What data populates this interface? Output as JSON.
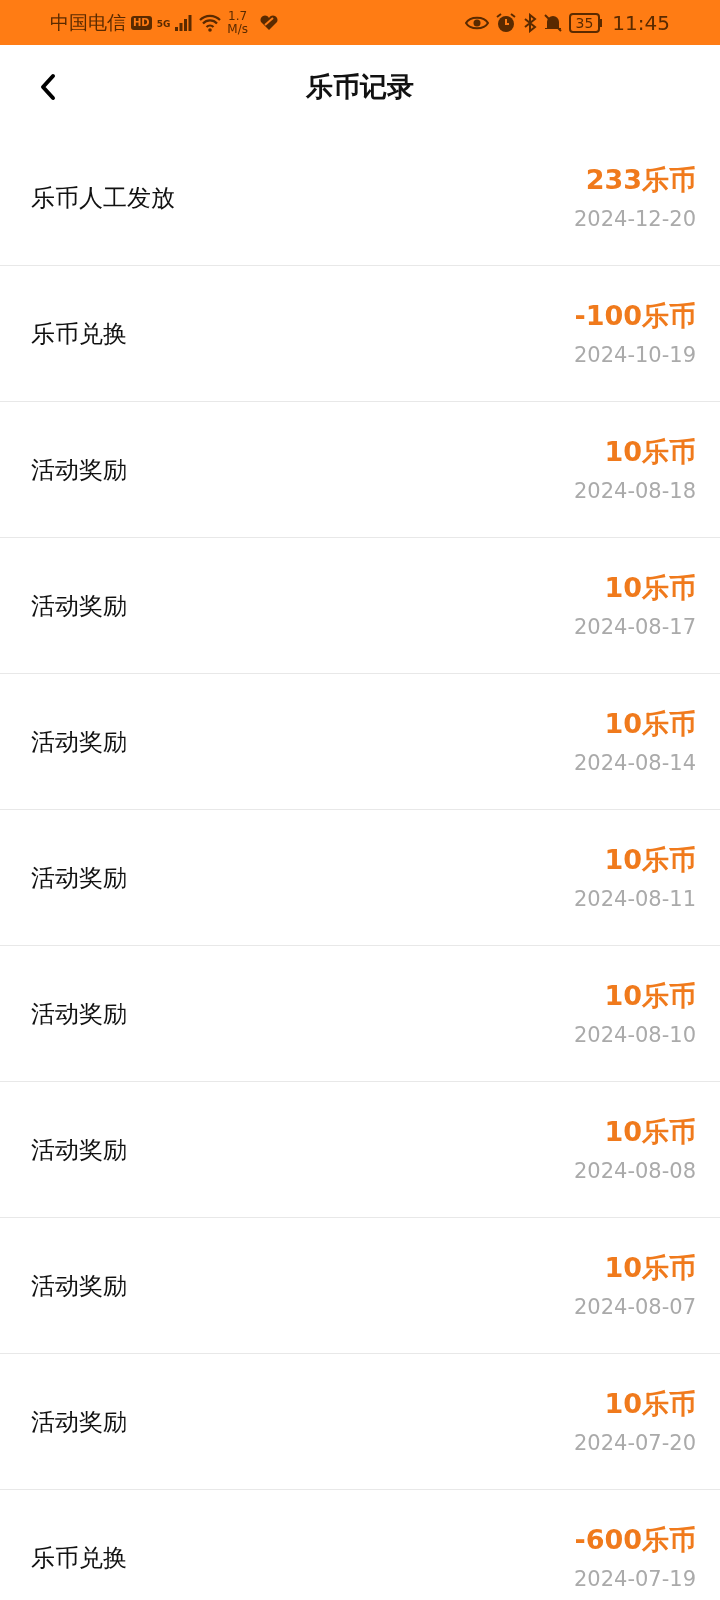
{
  "status_bar": {
    "carrier": "中国电信",
    "hd": "HD",
    "network": "5G",
    "speed_value": "1.7",
    "speed_unit": "M/s",
    "battery": "35",
    "time": "11:45"
  },
  "header": {
    "title": "乐币记录"
  },
  "records": [
    {
      "title": "乐币人工发放",
      "amount": "233乐币",
      "date": "2024-12-20"
    },
    {
      "title": "乐币兑换",
      "amount": "-100乐币",
      "date": "2024-10-19"
    },
    {
      "title": "活动奖励",
      "amount": "10乐币",
      "date": "2024-08-18"
    },
    {
      "title": "活动奖励",
      "amount": "10乐币",
      "date": "2024-08-17"
    },
    {
      "title": "活动奖励",
      "amount": "10乐币",
      "date": "2024-08-14"
    },
    {
      "title": "活动奖励",
      "amount": "10乐币",
      "date": "2024-08-11"
    },
    {
      "title": "活动奖励",
      "amount": "10乐币",
      "date": "2024-08-10"
    },
    {
      "title": "活动奖励",
      "amount": "10乐币",
      "date": "2024-08-08"
    },
    {
      "title": "活动奖励",
      "amount": "10乐币",
      "date": "2024-08-07"
    },
    {
      "title": "活动奖励",
      "amount": "10乐币",
      "date": "2024-07-20"
    },
    {
      "title": "乐币兑换",
      "amount": "-600乐币",
      "date": "2024-07-19"
    }
  ]
}
